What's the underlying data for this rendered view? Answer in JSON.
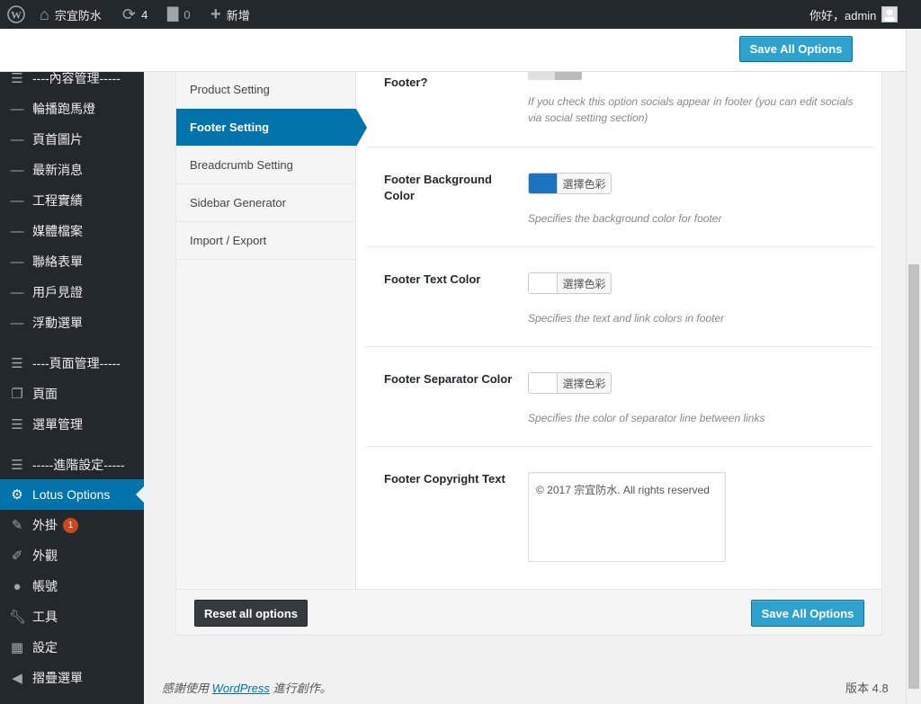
{
  "adminbar": {
    "wp_logo_icon": "wordpress-logo-icon",
    "site_name": "宗宜防水",
    "updates_count": "4",
    "comments_count": "0",
    "new_label": "新增",
    "greeting": "你好，admin"
  },
  "sidebar": {
    "items": [
      {
        "label": "----內容管理-----",
        "icon": "list-icon"
      },
      {
        "label": "輪播跑馬燈",
        "icon": "dash-icon"
      },
      {
        "label": "頁首圖片",
        "icon": "dash-icon"
      },
      {
        "label": "最新消息",
        "icon": "dash-icon"
      },
      {
        "label": "工程實績",
        "icon": "dash-icon"
      },
      {
        "label": "媒體檔案",
        "icon": "dash-icon"
      },
      {
        "label": "聯絡表單",
        "icon": "dash-icon"
      },
      {
        "label": "用戶見證",
        "icon": "dash-icon"
      },
      {
        "label": "浮動選單",
        "icon": "dash-icon"
      },
      {
        "label": "----頁面管理-----",
        "icon": "list-icon"
      },
      {
        "label": "頁面",
        "icon": "pages-icon"
      },
      {
        "label": "選單管理",
        "icon": "menu-icon"
      },
      {
        "label": "-----進階設定-----",
        "icon": "list-icon"
      },
      {
        "label": "Lotus Options",
        "icon": "gear-icon"
      },
      {
        "label": "外掛",
        "icon": "plugin-icon",
        "badge": "1"
      },
      {
        "label": "外觀",
        "icon": "brush-icon"
      },
      {
        "label": "帳號",
        "icon": "user-icon"
      },
      {
        "label": "工具",
        "icon": "wrench-icon"
      },
      {
        "label": "設定",
        "icon": "settings-icon"
      },
      {
        "label": "摺疊選單",
        "icon": "collapse-icon"
      }
    ]
  },
  "toolbar": {
    "save_label": "Save All Options",
    "reset_label": "Reset all options"
  },
  "tabs": [
    {
      "label": "Product Setting"
    },
    {
      "label": "Footer Setting"
    },
    {
      "label": "Breadcrumb Setting"
    },
    {
      "label": "Sidebar Generator"
    },
    {
      "label": "Import / Export"
    }
  ],
  "options": {
    "socials": {
      "label": "Footer?",
      "desc": "If you check this option socials appear in footer (you can edit socials via social setting section)"
    },
    "bg_color": {
      "label": "Footer Background Color",
      "picker_label": "選擇色彩",
      "color": "#1e73be",
      "desc": "Specifies the background color for footer"
    },
    "text_color": {
      "label": "Footer Text Color",
      "picker_label": "選擇色彩",
      "color": "#ffffff",
      "desc": "Specifies the text and link colors in footer"
    },
    "separator_color": {
      "label": "Footer Separator Color",
      "picker_label": "選擇色彩",
      "color": "#ffffff",
      "desc": "Specifies the color of separator line between links"
    },
    "copyright": {
      "label": "Footer Copyright Text",
      "value": "© 2017 宗宜防水. All rights reserved"
    }
  },
  "footer": {
    "thanks_prefix": "感謝使用",
    "wordpress_link": "WordPress",
    "thanks_suffix": "進行創作。",
    "version": "版本 4.8"
  }
}
